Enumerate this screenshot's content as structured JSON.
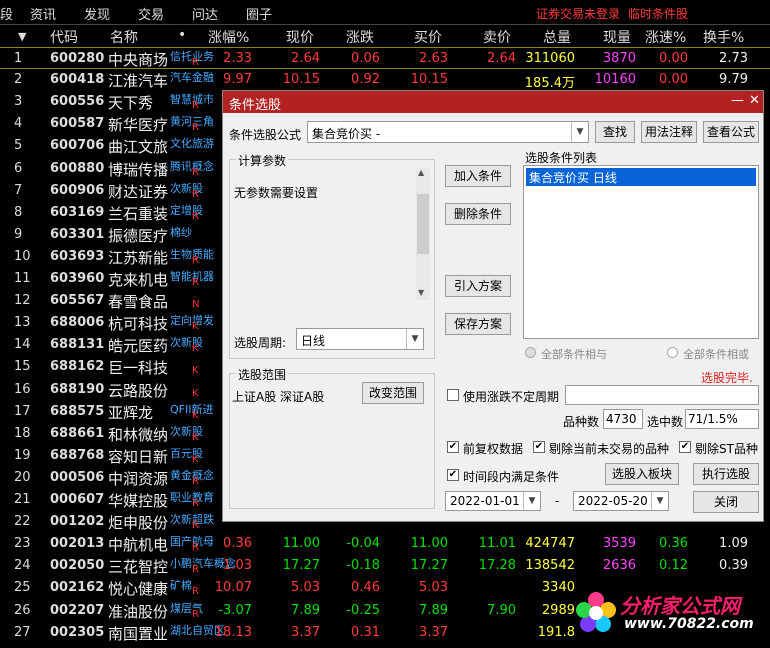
{
  "menu": {
    "items": [
      "段",
      "资讯",
      "发现",
      "交易",
      "问达",
      "圈子"
    ],
    "warn1": "证券交易未登录",
    "warn2": "临时条件股"
  },
  "headers": [
    "▼",
    "代码",
    "名称",
    "•",
    "涨幅%",
    "现价",
    "涨跌",
    "买价",
    "卖价",
    "总量",
    "现量",
    "涨速%",
    "换手%"
  ],
  "rows": [
    {
      "no": "1",
      "code": "600280",
      "name": "中央商场",
      "sector": "信托业务",
      "flag": "R",
      "pct": "2.33",
      "price": "2.64",
      "chg": "0.06",
      "buy": "2.63",
      "sell": "2.64",
      "vol": "311060",
      "cur": "3870",
      "speed": "0.00",
      "turn": "2.73"
    },
    {
      "no": "2",
      "code": "600418",
      "name": "江淮汽车",
      "sector": "汽车金融",
      "flag": "",
      "pct": "9.97",
      "price": "10.15",
      "chg": "0.92",
      "buy": "10.15",
      "sell": "",
      "vol": "185.4万",
      "cur": "10160",
      "speed": "0.00",
      "turn": "9.79"
    },
    {
      "no": "3",
      "code": "600556",
      "name": "天下秀",
      "sector": "智慧城市",
      "flag": "R"
    },
    {
      "no": "4",
      "code": "600587",
      "name": "新华医疗",
      "sector": "黄河三角",
      "flag": "R"
    },
    {
      "no": "5",
      "code": "600706",
      "name": "曲江文旅",
      "sector": "文化旅游",
      "flag": ""
    },
    {
      "no": "6",
      "code": "600880",
      "name": "博瑞传播",
      "sector": "腾讯概念",
      "flag": "R"
    },
    {
      "no": "7",
      "code": "600906",
      "name": "财达证券",
      "sector": "次新股",
      "flag": "R"
    },
    {
      "no": "8",
      "code": "603169",
      "name": "兰石重装",
      "sector": "定增股",
      "flag": "R"
    },
    {
      "no": "9",
      "code": "603301",
      "name": "振德医疗",
      "sector": "棉纱",
      "flag": ""
    },
    {
      "no": "10",
      "code": "603693",
      "name": "江苏新能",
      "sector": "生物质能",
      "flag": "R"
    },
    {
      "no": "11",
      "code": "603960",
      "name": "克来机电",
      "sector": "智能机器",
      "flag": "R"
    },
    {
      "no": "12",
      "code": "605567",
      "name": "春雪食品",
      "sector": "",
      "flag": "N"
    },
    {
      "no": "13",
      "code": "688006",
      "name": "杭可科技",
      "sector": "定向增发",
      "flag": "K"
    },
    {
      "no": "14",
      "code": "688131",
      "name": "皓元医药",
      "sector": "次新股",
      "flag": "K"
    },
    {
      "no": "15",
      "code": "688162",
      "name": "巨一科技",
      "sector": "",
      "flag": "K"
    },
    {
      "no": "16",
      "code": "688190",
      "name": "云路股份",
      "sector": "",
      "flag": "K"
    },
    {
      "no": "17",
      "code": "688575",
      "name": "亚辉龙",
      "sector": "QFII新进",
      "flag": "K"
    },
    {
      "no": "18",
      "code": "688661",
      "name": "和林微纳",
      "sector": "次新股",
      "flag": "K"
    },
    {
      "no": "19",
      "code": "688768",
      "name": "容知日新",
      "sector": "百元股",
      "flag": "K"
    },
    {
      "no": "20",
      "code": "000506",
      "name": "中润资源",
      "sector": "黄金概念",
      "flag": "R"
    },
    {
      "no": "21",
      "code": "000607",
      "name": "华媒控股",
      "sector": "职业教育",
      "flag": "R"
    },
    {
      "no": "22",
      "code": "001202",
      "name": "炬申股份",
      "sector": "次新超跌",
      "flag": "R"
    },
    {
      "no": "23",
      "code": "002013",
      "name": "中航机电",
      "sector": "国产航母",
      "flag": "R",
      "pct": "0.36",
      "price": "11.00",
      "chg": "-0.04",
      "buy": "11.00",
      "sell": "11.01",
      "vol": "424747",
      "cur": "3539",
      "speed": "0.36",
      "turn": "1.09"
    },
    {
      "no": "24",
      "code": "002050",
      "name": "三花智控",
      "sector": "小鹏汽车概念",
      "flag": "R",
      "pct": "1.03",
      "price": "17.27",
      "chg": "-0.18",
      "buy": "17.27",
      "sell": "17.28",
      "vol": "138542",
      "cur": "2636",
      "speed": "0.12",
      "turn": "0.39"
    },
    {
      "no": "25",
      "code": "002162",
      "name": "悦心健康",
      "sector": "矿棉",
      "flag": "R",
      "pct": "10.07",
      "price": "5.03",
      "chg": "0.46",
      "buy": "5.03",
      "sell": "",
      "vol": "3340",
      "cur": "",
      "speed": "",
      "turn": ""
    },
    {
      "no": "26",
      "code": "002207",
      "name": "准油股份",
      "sector": "煤层气",
      "flag": "R",
      "pct": "-3.07",
      "price": "7.89",
      "chg": "-0.25",
      "buy": "7.89",
      "sell": "7.90",
      "vol": "2989",
      "cur": "",
      "speed": "",
      "turn": ""
    },
    {
      "no": "27",
      "code": "002305",
      "name": "南国置业",
      "sector": "湖北自贸区",
      "flag": "",
      "pct": "18.13",
      "price": "3.37",
      "chg": "0.31",
      "buy": "3.37",
      "sell": "",
      "vol": "191.8",
      "cur": "",
      "speed": "",
      "turn": ""
    }
  ],
  "dialog": {
    "title": "条件选股",
    "formula_label": "条件选股公式",
    "formula_value": "集合竞价买  -",
    "btn_find": "查找",
    "btn_usage": "用法注释",
    "btn_view": "查看公式",
    "calc_group": "计算参数",
    "no_param": "无参数需要设置",
    "btn_add": "加入条件",
    "btn_del": "删除条件",
    "list_label": "选股条件列表",
    "list_item": "集合竞价买  日线",
    "btn_import": "引入方案",
    "btn_save": "保存方案",
    "period_label": "选股周期:",
    "period_value": "日线",
    "radio_and": "全部条件相与",
    "radio_or": "全部条件相或",
    "done": "选股完毕.",
    "range_group": "选股范围",
    "range_value": "上证A股 深证A股",
    "btn_range": "改变范围",
    "use_period": "使用涨跌不定周期",
    "count_label": "品种数",
    "count_value": "4730",
    "sel_label": "选中数",
    "sel_value": "71/1.5%",
    "chk_fq": "前复权数据",
    "chk_exclude": "剔除当前未交易的品种",
    "chk_st": "剔除ST品种",
    "chk_time": "时间段内满足条件",
    "btn_to_block": "选股入板块",
    "btn_exec": "执行选股",
    "date_from": "2022-01-01",
    "date_to": "2022-05-20",
    "dash": "-",
    "btn_close": "关闭"
  },
  "logo": {
    "text": "分析家公式网",
    "url": "www.70822.com"
  },
  "colors": {
    "title_bar": "#b22222",
    "up": "#ff3a3a",
    "down": "#00e000",
    "sector": "#44aaff"
  }
}
